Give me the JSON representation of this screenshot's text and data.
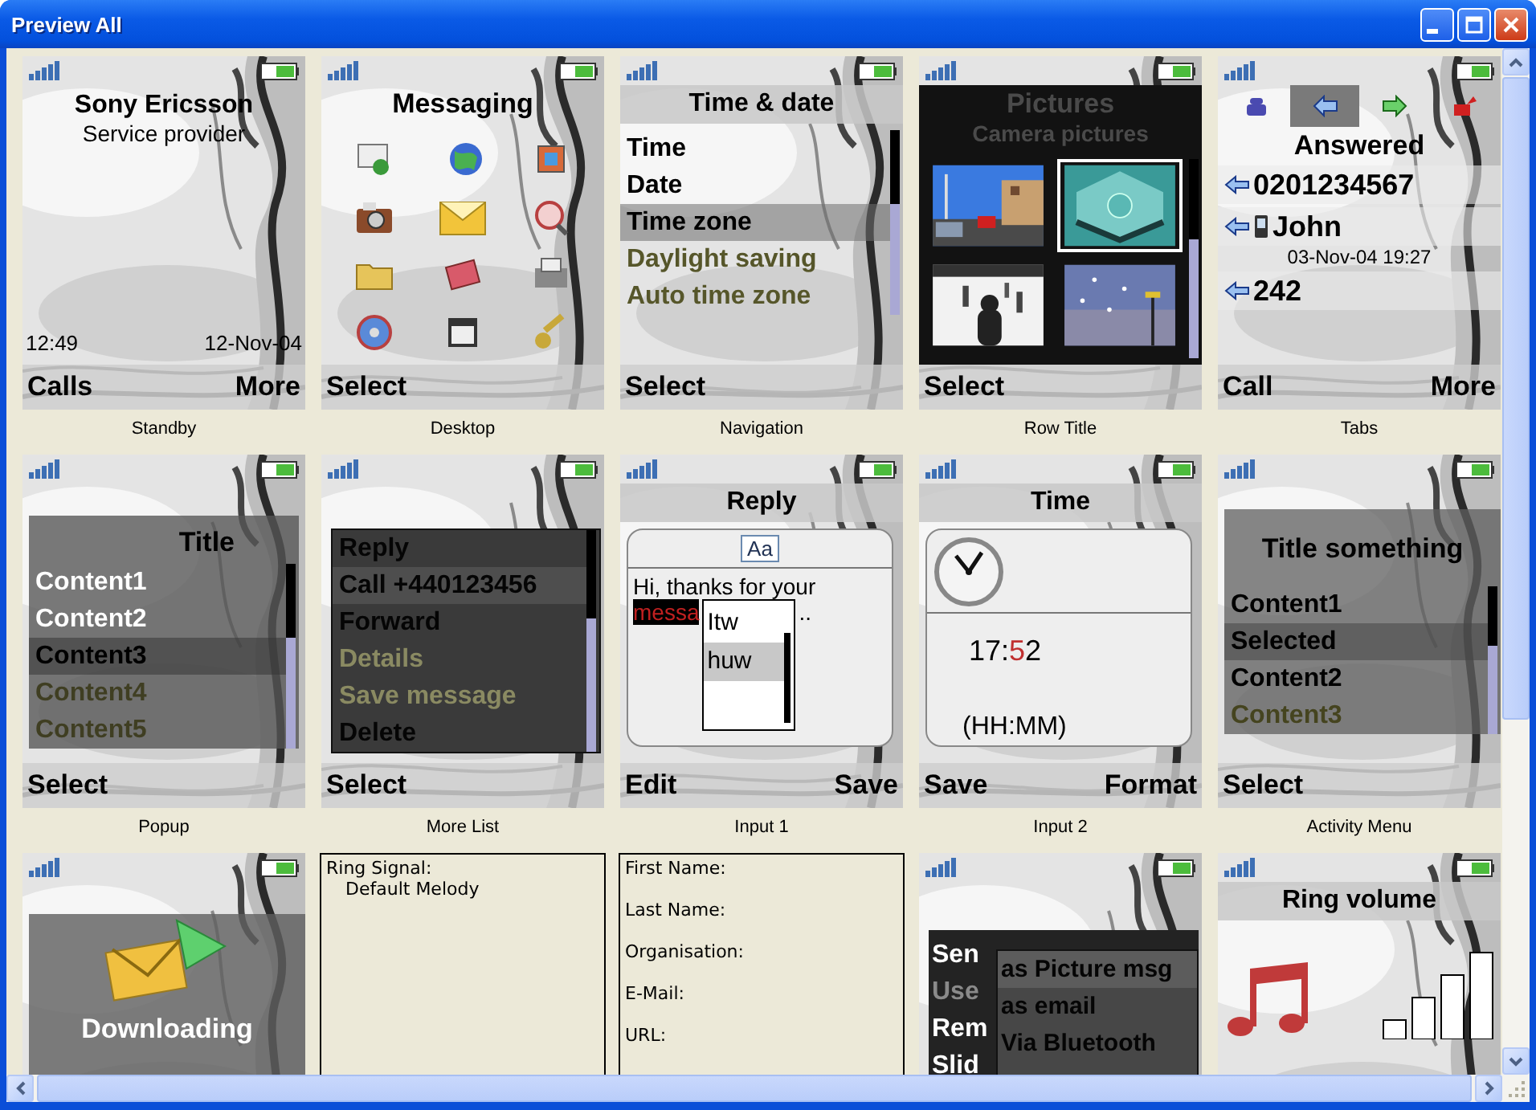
{
  "window": {
    "title": "Preview All"
  },
  "tiles": [
    {
      "kind": "standby",
      "caption": "Standby",
      "operator": "Sony Ericsson",
      "subtitle": "Service provider",
      "time": "12:49",
      "date": "12-Nov-04",
      "soft_left": "Calls",
      "soft_right": "More"
    },
    {
      "kind": "desktop",
      "caption": "Desktop",
      "title": "Messaging",
      "soft_left": "Select"
    },
    {
      "kind": "list_menu",
      "caption": "Navigation",
      "title": "Time & date",
      "items": [
        {
          "label": "Time",
          "selected": false,
          "disabled": false
        },
        {
          "label": "Date",
          "selected": false,
          "disabled": false
        },
        {
          "label": "Time zone",
          "selected": true,
          "disabled": false
        },
        {
          "label": "Daylight saving",
          "selected": false,
          "disabled": true
        },
        {
          "label": "Auto time zone",
          "selected": false,
          "disabled": true
        }
      ],
      "soft_left": "Select"
    },
    {
      "kind": "pictures",
      "caption": "Row Title",
      "title": "Pictures",
      "subtitle": "Camera pictures",
      "thumbnails": [
        {
          "kind": "picture",
          "selected": false
        },
        {
          "kind": "picture",
          "selected": true
        },
        {
          "kind": "picture",
          "selected": false
        },
        {
          "kind": "picture",
          "selected": false
        }
      ],
      "soft_left": "Select"
    },
    {
      "kind": "tabs",
      "caption": "Tabs",
      "tabs": [
        {
          "selected": false
        },
        {
          "selected": true
        },
        {
          "selected": false
        },
        {
          "selected": false
        }
      ],
      "heading": "Answered",
      "entries": [
        {
          "kind": "number",
          "text": "0201234567"
        },
        {
          "kind": "contact",
          "text": "John",
          "detail": "03-Nov-04 19:27"
        },
        {
          "kind": "number",
          "text": "242"
        }
      ],
      "soft_left": "Call",
      "soft_right": "More"
    },
    {
      "kind": "popup_menu",
      "caption": "Popup",
      "title": "Title",
      "items": [
        {
          "label": "Content1",
          "selected": false,
          "disabled": false
        },
        {
          "label": "Content2",
          "selected": false,
          "disabled": false
        },
        {
          "label": "Content3",
          "selected": true,
          "disabled": false
        },
        {
          "label": "Content4",
          "selected": false,
          "disabled": true
        },
        {
          "label": "Content5",
          "selected": false,
          "disabled": true
        }
      ],
      "soft_left": "Select"
    },
    {
      "kind": "more_list",
      "caption": "More List",
      "items": [
        {
          "label": "Reply",
          "selected": false,
          "disabled": false
        },
        {
          "label": "Call +440123456",
          "selected": true,
          "disabled": false
        },
        {
          "label": "Forward",
          "selected": false,
          "disabled": false
        },
        {
          "label": "Details",
          "selected": false,
          "disabled": true
        },
        {
          "label": "Save message",
          "selected": false,
          "disabled": true
        },
        {
          "label": "Delete",
          "selected": false,
          "disabled": false
        }
      ],
      "soft_left": "Select"
    },
    {
      "kind": "input_text",
      "caption": "Input 1",
      "title": "Reply",
      "mode": "Aa",
      "text": "Hi, thanks for your",
      "word": "messa",
      "after": "..",
      "suggestions": [
        {
          "label": "Itw",
          "selected": false
        },
        {
          "label": "huw",
          "selected": true
        }
      ],
      "soft_left": "Edit",
      "soft_right": "Save"
    },
    {
      "kind": "input_time",
      "caption": "Input 2",
      "title": "Time",
      "value_before": "17:",
      "value_cursor": "5",
      "value_after": "2",
      "format": "(HH:MM)",
      "soft_left": "Save",
      "soft_right": "Format"
    },
    {
      "kind": "activity_menu",
      "caption": "Activity Menu",
      "title": "Title something",
      "items": [
        {
          "label": "Content1",
          "selected": false,
          "disabled": false
        },
        {
          "label": "Selected",
          "selected": true,
          "disabled": false
        },
        {
          "label": "Content2",
          "selected": false,
          "disabled": false
        },
        {
          "label": "Content3",
          "selected": false,
          "disabled": true
        }
      ],
      "soft_left": "Select"
    },
    {
      "kind": "downloading",
      "text": "Downloading"
    },
    {
      "kind": "fields",
      "lines": [
        {
          "label": "Ring Signal:",
          "value": "Default Melody"
        }
      ]
    },
    {
      "kind": "fields",
      "lines": [
        {
          "label": "First Name:"
        },
        {
          "label": "Last Name:"
        },
        {
          "label": "Organisation:"
        },
        {
          "label": "E-Mail:"
        },
        {
          "label": "URL:"
        }
      ]
    },
    {
      "kind": "send",
      "items": [
        {
          "label": "Sen",
          "disabled": false
        },
        {
          "label": "Use",
          "disabled": true
        },
        {
          "label": "Rem",
          "disabled": false
        },
        {
          "label": "Slid",
          "disabled": false
        }
      ],
      "submenu": [
        {
          "label": "as Picture msg",
          "selected": true
        },
        {
          "label": "as email",
          "selected": false
        },
        {
          "label": "Via Bluetooth",
          "selected": false
        }
      ]
    },
    {
      "kind": "volume",
      "title": "Ring volume"
    }
  ]
}
